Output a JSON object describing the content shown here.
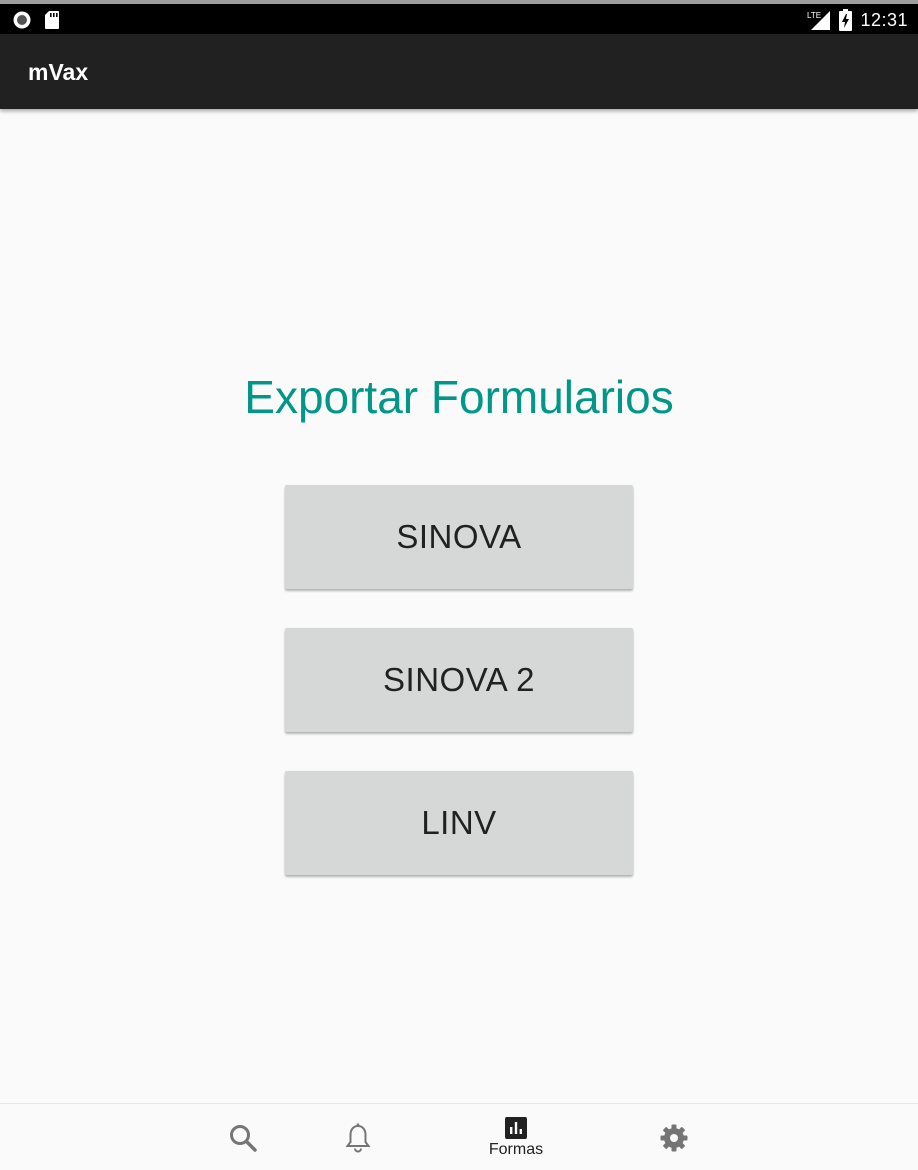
{
  "status_bar": {
    "time": "12:31",
    "network": "LTE",
    "left_icons": [
      "record-icon",
      "sd-card-icon"
    ],
    "right_icons": [
      "signal-icon",
      "battery-charging-icon"
    ]
  },
  "app_bar": {
    "title": "mVax"
  },
  "main": {
    "heading": "Exportar Formularios",
    "buttons": [
      {
        "label": "SINOVA"
      },
      {
        "label": "SINOVA 2"
      },
      {
        "label": "LINV"
      }
    ]
  },
  "bottom_nav": {
    "items": [
      {
        "icon": "search-icon",
        "label": ""
      },
      {
        "icon": "bell-icon",
        "label": ""
      },
      {
        "icon": "bar-chart-icon",
        "label": "Formas"
      },
      {
        "icon": "gear-icon",
        "label": ""
      }
    ]
  },
  "colors": {
    "status_bar": "#000000",
    "app_bar": "#212121",
    "heading": "#009688",
    "button": "#d6d7d7",
    "background": "#fafafa"
  }
}
